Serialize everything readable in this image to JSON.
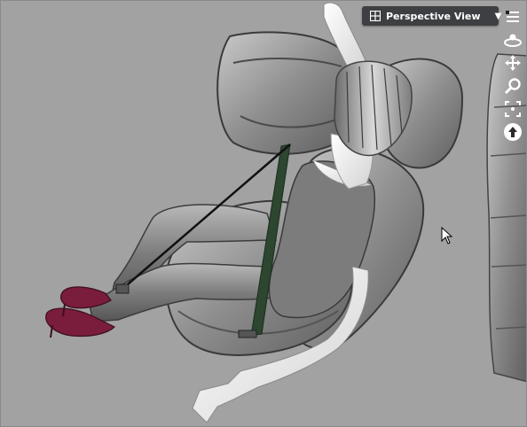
{
  "viewport": {
    "view_name": "Perspective View",
    "dropdown_caret": "▼",
    "background_color": "#a2a2a2",
    "header_bar_color": "#3d3f42"
  },
  "nav_tools": [
    {
      "icon": "pane-options-icon"
    },
    {
      "icon": "orbit-icon"
    },
    {
      "icon": "pan-icon"
    },
    {
      "icon": "zoom-icon"
    },
    {
      "icon": "frame-icon"
    },
    {
      "icon": "aim-icon"
    }
  ],
  "scene": {
    "subject": "female-figure-in-car-seat",
    "shoe_color": "#7a1c3c",
    "belt_color": "#2c4630"
  }
}
